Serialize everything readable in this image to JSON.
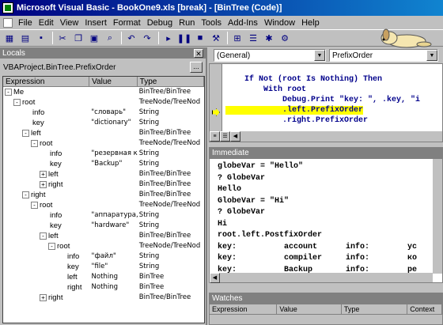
{
  "window": {
    "title": "Microsoft Visual Basic - BookOne9.xls [break] - [BinTree (Code)]"
  },
  "menu": [
    "File",
    "Edit",
    "View",
    "Insert",
    "Format",
    "Debug",
    "Run",
    "Tools",
    "Add-Ins",
    "Window",
    "Help"
  ],
  "locals": {
    "panel_title": "Locals",
    "context": "VBAProject.BinTree.PrefixOrder",
    "context_button": "...",
    "columns": [
      "Expression",
      "Value",
      "Type"
    ],
    "rows": [
      {
        "indent": 0,
        "expander": "-",
        "expr": "Me",
        "value": "",
        "type": "BinTree/BinTree"
      },
      {
        "indent": 1,
        "expander": "-",
        "expr": "root",
        "value": "",
        "type": "TreeNode/TreeNod"
      },
      {
        "indent": 2,
        "expander": "",
        "expr": "info",
        "value": "\"словарь\"",
        "type": "String"
      },
      {
        "indent": 2,
        "expander": "",
        "expr": "key",
        "value": "\"dictionary\"",
        "type": "String"
      },
      {
        "indent": 2,
        "expander": "-",
        "expr": "left",
        "value": "",
        "type": "BinTree/BinTree"
      },
      {
        "indent": 3,
        "expander": "-",
        "expr": "root",
        "value": "",
        "type": "TreeNode/TreeNod"
      },
      {
        "indent": 4,
        "expander": "",
        "expr": "info",
        "value": "\"резервная ког",
        "type": "String"
      },
      {
        "indent": 4,
        "expander": "",
        "expr": "key",
        "value": "\"Backup\"",
        "type": "String"
      },
      {
        "indent": 4,
        "expander": "+",
        "expr": "left",
        "value": "",
        "type": "BinTree/BinTree"
      },
      {
        "indent": 4,
        "expander": "+",
        "expr": "right",
        "value": "",
        "type": "BinTree/BinTree"
      },
      {
        "indent": 2,
        "expander": "-",
        "expr": "right",
        "value": "",
        "type": "BinTree/BinTree"
      },
      {
        "indent": 3,
        "expander": "-",
        "expr": "root",
        "value": "",
        "type": "TreeNode/TreeNod"
      },
      {
        "indent": 4,
        "expander": "",
        "expr": "info",
        "value": "\"аппаратура, ё",
        "type": "String"
      },
      {
        "indent": 4,
        "expander": "",
        "expr": "key",
        "value": "\"hardware\"",
        "type": "String"
      },
      {
        "indent": 4,
        "expander": "-",
        "expr": "left",
        "value": "",
        "type": "BinTree/BinTree"
      },
      {
        "indent": 5,
        "expander": "-",
        "expr": "root",
        "value": "",
        "type": "TreeNode/TreeNod"
      },
      {
        "indent": 6,
        "expander": "",
        "expr": "info",
        "value": "\"файл\"",
        "type": "String"
      },
      {
        "indent": 6,
        "expander": "",
        "expr": "key",
        "value": "\"file\"",
        "type": "String"
      },
      {
        "indent": 6,
        "expander": "",
        "expr": "left",
        "value": "Nothing",
        "type": "BinTree"
      },
      {
        "indent": 6,
        "expander": "",
        "expr": "right",
        "value": "Nothing",
        "type": "BinTree"
      },
      {
        "indent": 4,
        "expander": "+",
        "expr": "right",
        "value": "",
        "type": "BinTree/BinTree"
      }
    ]
  },
  "code_window": {
    "object_combo": "(General)",
    "proc_combo": "PrefixOrder",
    "lines": [
      "    If Not (root Is Nothing) Then",
      "        With root",
      "            Debug.Print \"key: \", .key, \"i",
      "            .left.PrefixOrder",
      "            .right.PrefixOrder"
    ],
    "highlight_line": 3
  },
  "immediate": {
    "panel_title": "Immediate",
    "lines": [
      "globeVar = \"Hello\"",
      "? GlobeVar",
      "Hello",
      "GlobeVar = \"Hi\"",
      "? GlobeVar",
      "Hi",
      "root.left.PostfixOrder",
      "key:          account      info:        ус",
      "key:          compiler     info:        ко",
      "key:          Backup       info:        ре"
    ]
  },
  "watches": {
    "panel_title": "Watches",
    "columns": [
      "Expression",
      "Value",
      "Type",
      "Context"
    ]
  },
  "colors": {
    "titlebar": "#000080",
    "highlight": "#ffff00",
    "code": "#00008b"
  }
}
